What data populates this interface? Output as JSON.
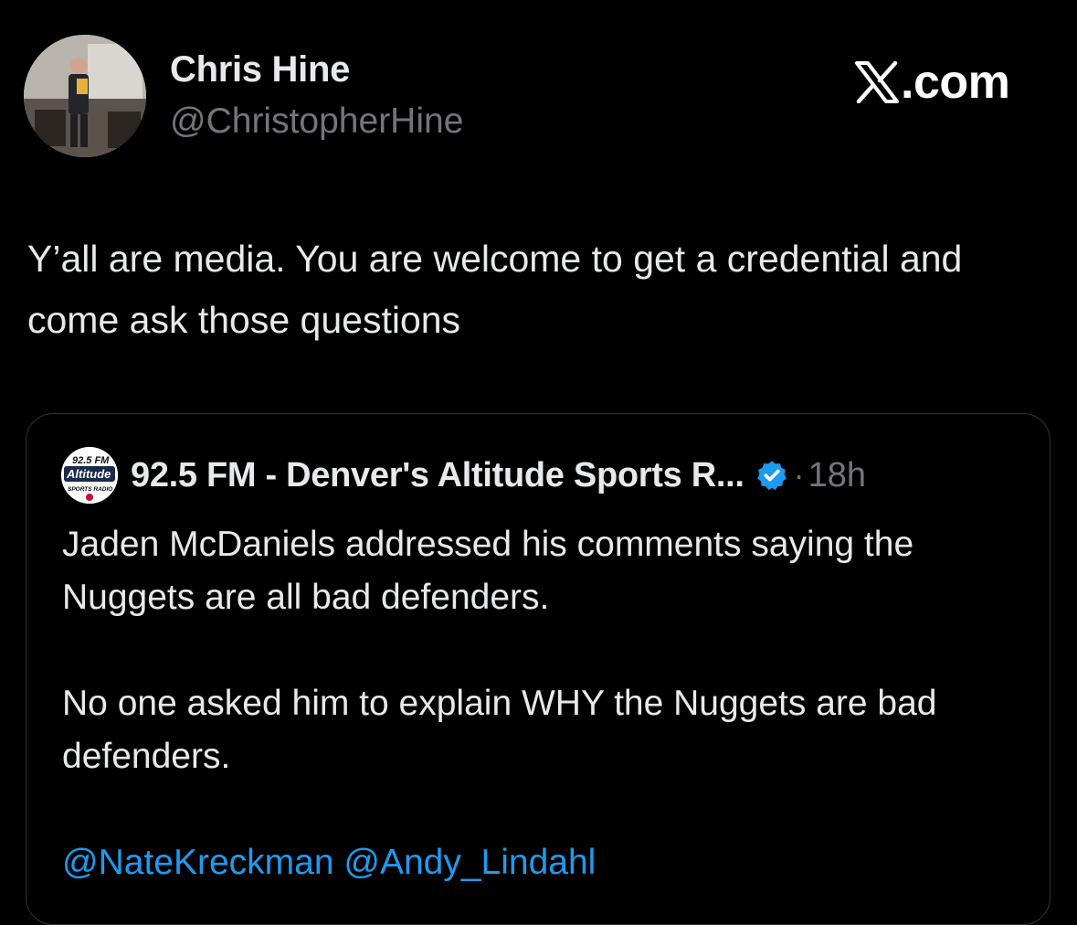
{
  "author": {
    "name": "Chris Hine",
    "handle": "@ChristopherHine",
    "avatar_icon": "profile-photo"
  },
  "brand": {
    "icon": "x-logo-icon",
    "label": ".com"
  },
  "tweet": {
    "text": "Y’all are media. You are welcome to get a credential and come ask those questions"
  },
  "quoted_tweet": {
    "avatar": {
      "line1": "92.5 FM",
      "line2": "Altitude",
      "line3": "SPORTS RADIO"
    },
    "name": "92.5 FM - Denver's Altitude Sports R...",
    "verified_icon": "verified-badge-icon",
    "separator": "·",
    "time": "18h",
    "paragraphs": [
      "Jaden McDaniels addressed his comments saying the Nuggets are all bad defenders.",
      "No one asked him to explain WHY the Nuggets are bad defenders."
    ],
    "mentions": [
      "@NateKreckman",
      "@Andy_Lindahl"
    ]
  },
  "colors": {
    "background": "#000000",
    "primary_text": "#e7e9ea",
    "secondary_text": "#71767b",
    "link": "#1d9bf0",
    "verified": "#1d9bf0",
    "card_border": "#2f3336"
  }
}
